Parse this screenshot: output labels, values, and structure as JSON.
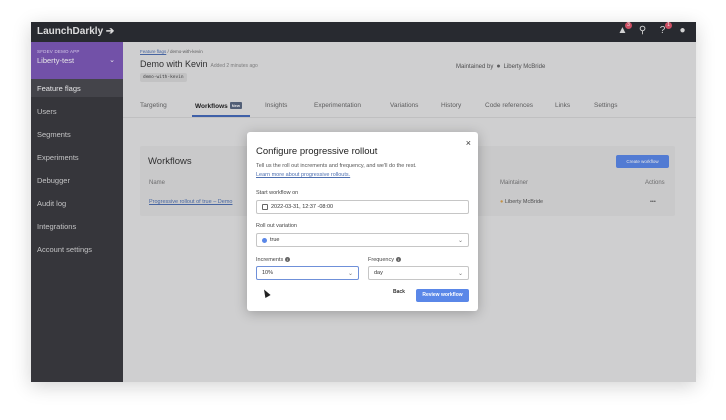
{
  "topbar": {
    "logo": "LaunchDarkly ➔",
    "notif_count": "3",
    "help_count": "1"
  },
  "sidebar": {
    "project_small": "SFDEV DEMO APP",
    "project_name": "Liberty-test",
    "items": [
      {
        "label": "Feature flags",
        "active": true
      },
      {
        "label": "Users"
      },
      {
        "label": "Segments"
      },
      {
        "label": "Experiments"
      },
      {
        "label": "Debugger"
      },
      {
        "label": "Audit log"
      },
      {
        "label": "Integrations"
      },
      {
        "label": "Account settings"
      }
    ]
  },
  "header": {
    "breadcrumb_link": "Feature flags",
    "breadcrumb_rest": " / demo-with-kevin",
    "title": "Demo with Kevin",
    "added": "Added 2 minutes ago",
    "flag_key": "demo-with-kevin",
    "maintained_by": "Maintained by",
    "maintainer": "Liberty McBride"
  },
  "tabs": [
    {
      "label": "Targeting"
    },
    {
      "label": "Workflows",
      "badge": "New",
      "active": true
    },
    {
      "label": "Insights"
    },
    {
      "label": "Experimentation"
    },
    {
      "label": "Variations"
    },
    {
      "label": "History"
    },
    {
      "label": "Code references"
    },
    {
      "label": "Links"
    },
    {
      "label": "Settings"
    }
  ],
  "workflows": {
    "title": "Workflows",
    "create_button": "Create workflow",
    "columns": [
      "Name",
      "Maintainer",
      "Actions"
    ],
    "row": {
      "name": "Progressive rollout of true – Demo",
      "maintainer": "Liberty McBride",
      "actions": "•••"
    }
  },
  "modal": {
    "title": "Configure progressive rollout",
    "description": "Tell us the roll out increments and frequency, and we'll do the rest.",
    "link": "Learn more about progressive rollouts.",
    "start_label": "Start workflow on",
    "start_value": "2022-03-31, 12:37 -08:00",
    "variation_label": "Roll out variation",
    "variation_value": "true",
    "increments_label": "Increments",
    "increments_value": "10%",
    "frequency_label": "Frequency",
    "frequency_value": "day",
    "back_button": "Back",
    "review_button": "Review workflow",
    "close_symbol": "×"
  },
  "colors": {
    "accent": "#5a87e8",
    "project": "#7d58b8",
    "topbar": "#2b2d33",
    "sidebar": "#3a3a3f"
  }
}
